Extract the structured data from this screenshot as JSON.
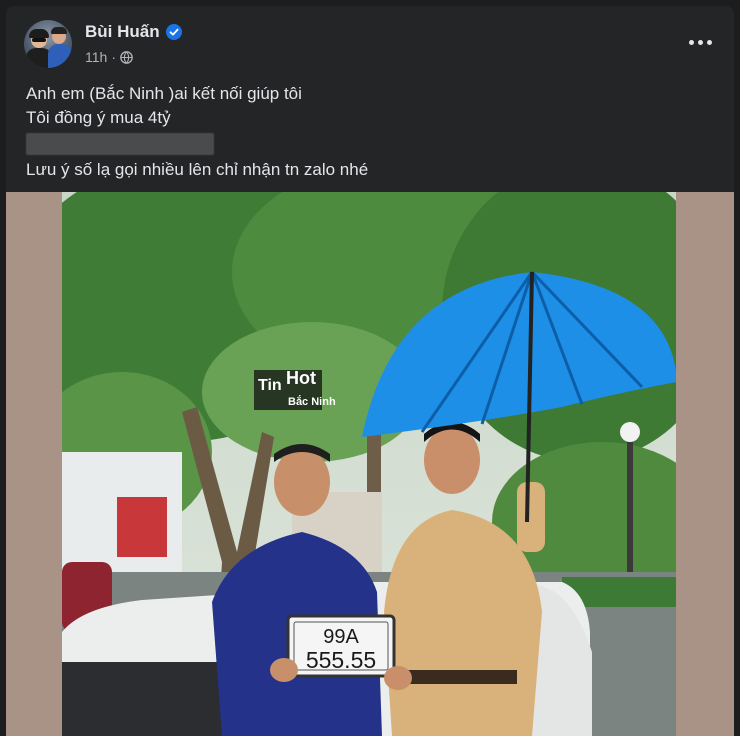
{
  "post": {
    "author": "Bùi Huấn",
    "time": "11h",
    "audience_icon": "globe-icon",
    "verified_icon": "verified-badge-icon",
    "more_icon": "more-options-icon",
    "lines": [
      "Anh em (Bắc Ninh )ai kết nối giúp tôi",
      "Tôi đồng ý mua 4tỷ",
      "Lưu ý số lạ gọi nhiều lên chỉ nhận tn zalo nhé"
    ]
  },
  "photo": {
    "watermark_main_a": "Tin",
    "watermark_main_b": "Hot",
    "watermark_sub": "Bắc Ninh",
    "plate_line1": "99A",
    "plate_line2": "555.55"
  },
  "colors": {
    "background": "#242526",
    "text": "#e4e6eb",
    "secondary_text": "#b0b3b8",
    "verified": "#1b74e4"
  }
}
